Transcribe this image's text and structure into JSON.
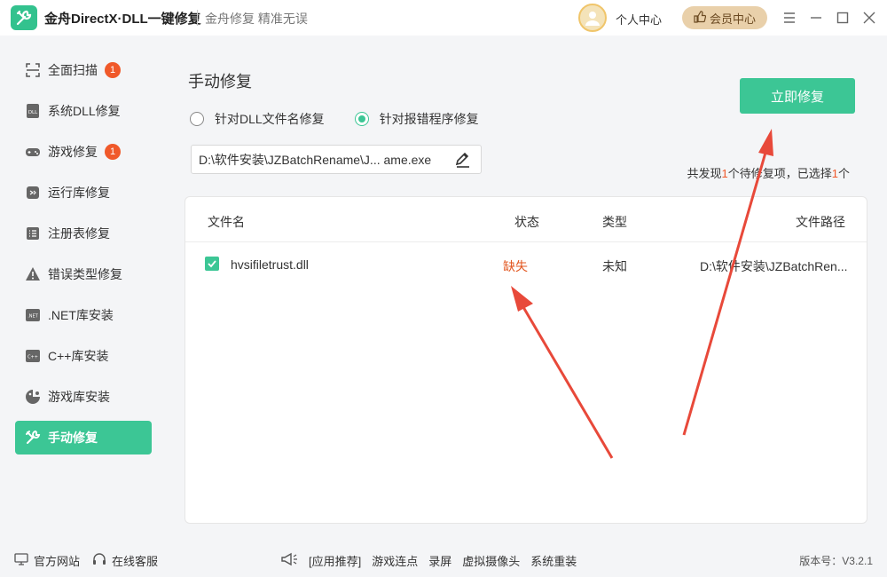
{
  "app": {
    "title": "金舟DirectX·DLL一键修复",
    "subtitle": "金舟修复 精准无误",
    "profile_label": "个人中心",
    "vip_label": "会员中心"
  },
  "sidebar": {
    "items": [
      {
        "label": "全面扫描",
        "icon": "scan-icon",
        "badge": "1"
      },
      {
        "label": "系统DLL修复",
        "icon": "dll-icon"
      },
      {
        "label": "游戏修复",
        "icon": "gamepad-icon",
        "badge": "1"
      },
      {
        "label": "运行库修复",
        "icon": "runtime-icon"
      },
      {
        "label": "注册表修复",
        "icon": "registry-icon"
      },
      {
        "label": "错误类型修复",
        "icon": "warning-icon"
      },
      {
        "label": ".NET库安装",
        "icon": "dotnet-icon"
      },
      {
        "label": "C++库安装",
        "icon": "cpp-icon"
      },
      {
        "label": "游戏库安装",
        "icon": "game-lib-icon"
      },
      {
        "label": "手动修复",
        "icon": "tools-icon",
        "active": true
      }
    ]
  },
  "main": {
    "title": "手动修复",
    "options": {
      "by_dll_name": "针对DLL文件名修复",
      "by_program": "针对报错程序修复",
      "selected": "by_program"
    },
    "path_value": "D:\\软件安装\\JZBatchRename\\J...  ame.exe",
    "repair_button": "立即修复",
    "found": {
      "prefix": "共发现",
      "count": "1",
      "middle": "个待修复项，已选择",
      "selected": "1",
      "suffix": "个"
    },
    "table": {
      "headers": {
        "name": "文件名",
        "status": "状态",
        "type": "类型",
        "path": "文件路径"
      },
      "rows": [
        {
          "checked": true,
          "name": "hvsifiletrust.dll",
          "status": "缺失",
          "type": "未知",
          "path": "D:\\软件安装\\JZBatchRen..."
        }
      ]
    }
  },
  "footer": {
    "official_site": "官方网站",
    "online_service": "在线客服",
    "recommend_label": "[应用推荐]",
    "links": [
      "游戏连点",
      "录屏",
      "虚拟摄像头",
      "系统重装"
    ],
    "version": "版本号：V3.2.1"
  },
  "colors": {
    "accent": "#3cc695",
    "badge": "#f0592a",
    "missing": "#e2561f",
    "annotation_arrow": "#e8493a"
  }
}
